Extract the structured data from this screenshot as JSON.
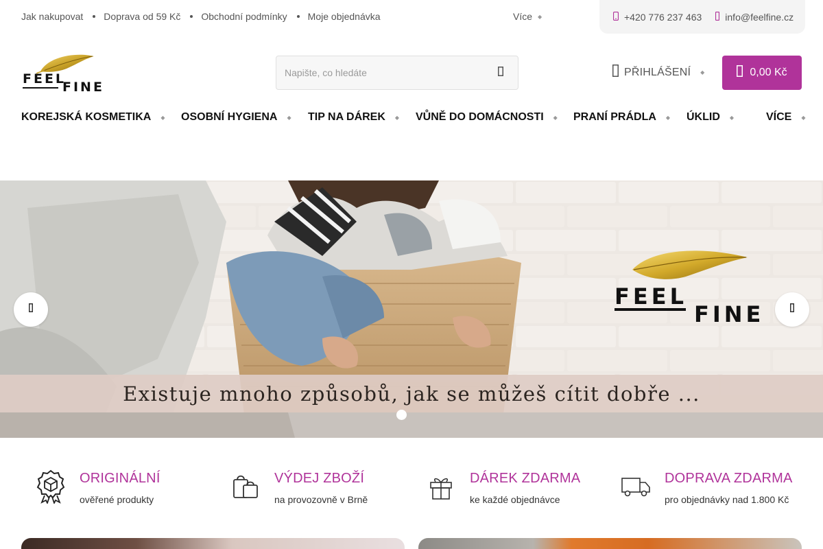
{
  "topbar": {
    "links": [
      "Jak nakupovat",
      "Doprava od 59 Kč",
      "Obchodní podmínky",
      "Moje objednávka"
    ],
    "more_label": "Více",
    "phone": "+420 776 237 463",
    "email": "info@feelfine.cz"
  },
  "header": {
    "logo_text_line1": "FEEL",
    "logo_text_line2": "FINE",
    "search_placeholder": "Napište, co hledáte",
    "login_label": "PŘIHLÁŠENÍ",
    "cart_total": "0,00 Kč"
  },
  "nav": {
    "items": [
      "KOREJSKÁ KOSMETIKA",
      "OSOBNÍ HYGIENA",
      "TIP NA DÁREK",
      "VŮNĚ DO DOMÁCNOSTI",
      "PRANÍ PRÁDLA",
      "ÚKLID",
      "VÍCE"
    ]
  },
  "hero": {
    "logo_line1": "FEEL",
    "logo_line2": "FINE",
    "caption": "Existuje mnoho způsobů, jak se můžeš cítit dobře ...",
    "slide_count": 1,
    "active_slide": 1
  },
  "features": [
    {
      "icon": "certificate-icon",
      "title": "ORIGINÁLNÍ",
      "subtitle": "ověřené produkty"
    },
    {
      "icon": "shopping-bags-icon",
      "title": "VÝDEJ ZBOŽÍ",
      "subtitle": "na provozovně v Brně"
    },
    {
      "icon": "gift-icon",
      "title": "DÁREK ZDARMA",
      "subtitle": "ke každé objednávce"
    },
    {
      "icon": "truck-icon",
      "title": "DOPRAVA ZDARMA",
      "subtitle": "pro objednávky nad 1.800 Kč"
    }
  ],
  "colors": {
    "accent": "#b0339a",
    "gold": "#c9a227",
    "text": "#111111"
  }
}
